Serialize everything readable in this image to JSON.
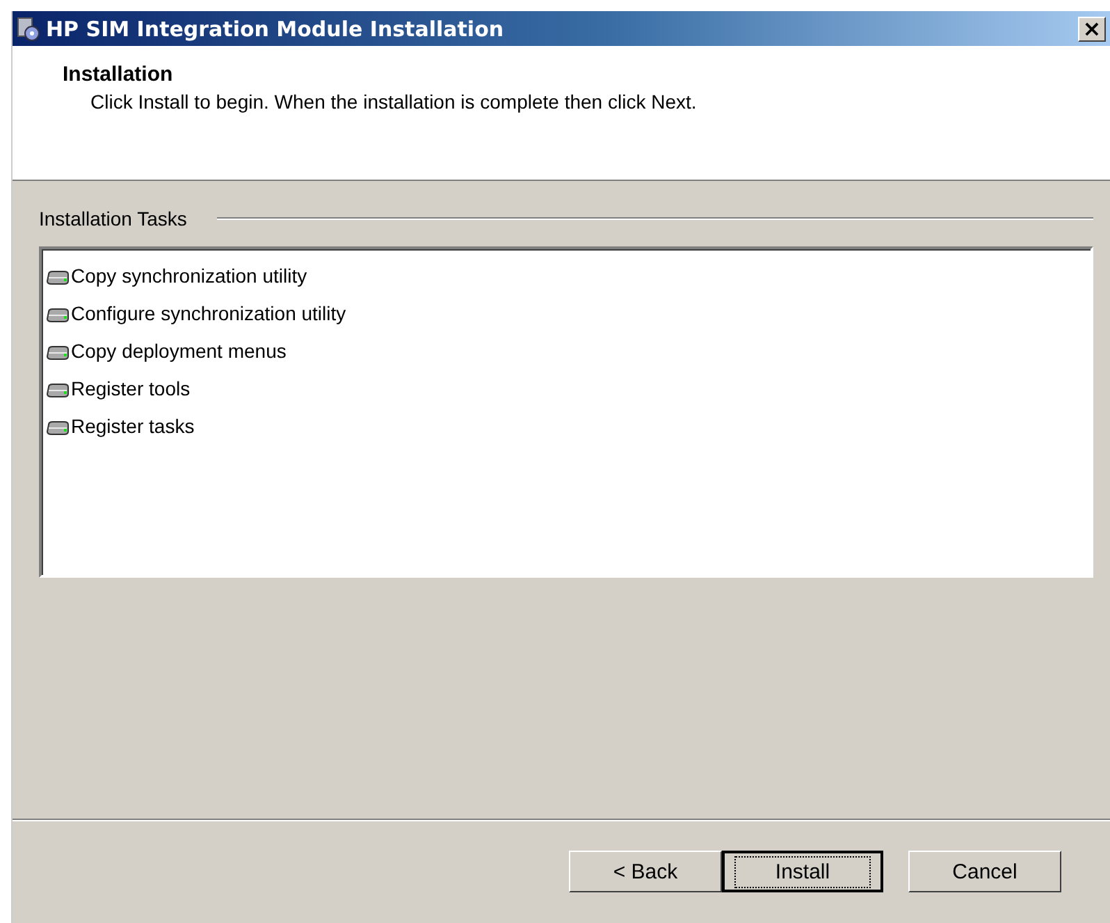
{
  "window": {
    "title": "HP SIM Integration Module Installation",
    "close": "×"
  },
  "header": {
    "title": "Installation",
    "subtitle": "Click Install to begin. When the installation is complete then click Next."
  },
  "group": {
    "label": "Installation Tasks",
    "tasks": [
      {
        "label": "Copy synchronization utility"
      },
      {
        "label": "Configure synchronization utility"
      },
      {
        "label": "Copy deployment menus"
      },
      {
        "label": "Register tools"
      },
      {
        "label": "Register tasks"
      }
    ]
  },
  "buttons": [
    {
      "label": "< Back",
      "default": false
    },
    {
      "label": "Install",
      "default": true
    },
    {
      "label": "Cancel",
      "default": false
    }
  ]
}
